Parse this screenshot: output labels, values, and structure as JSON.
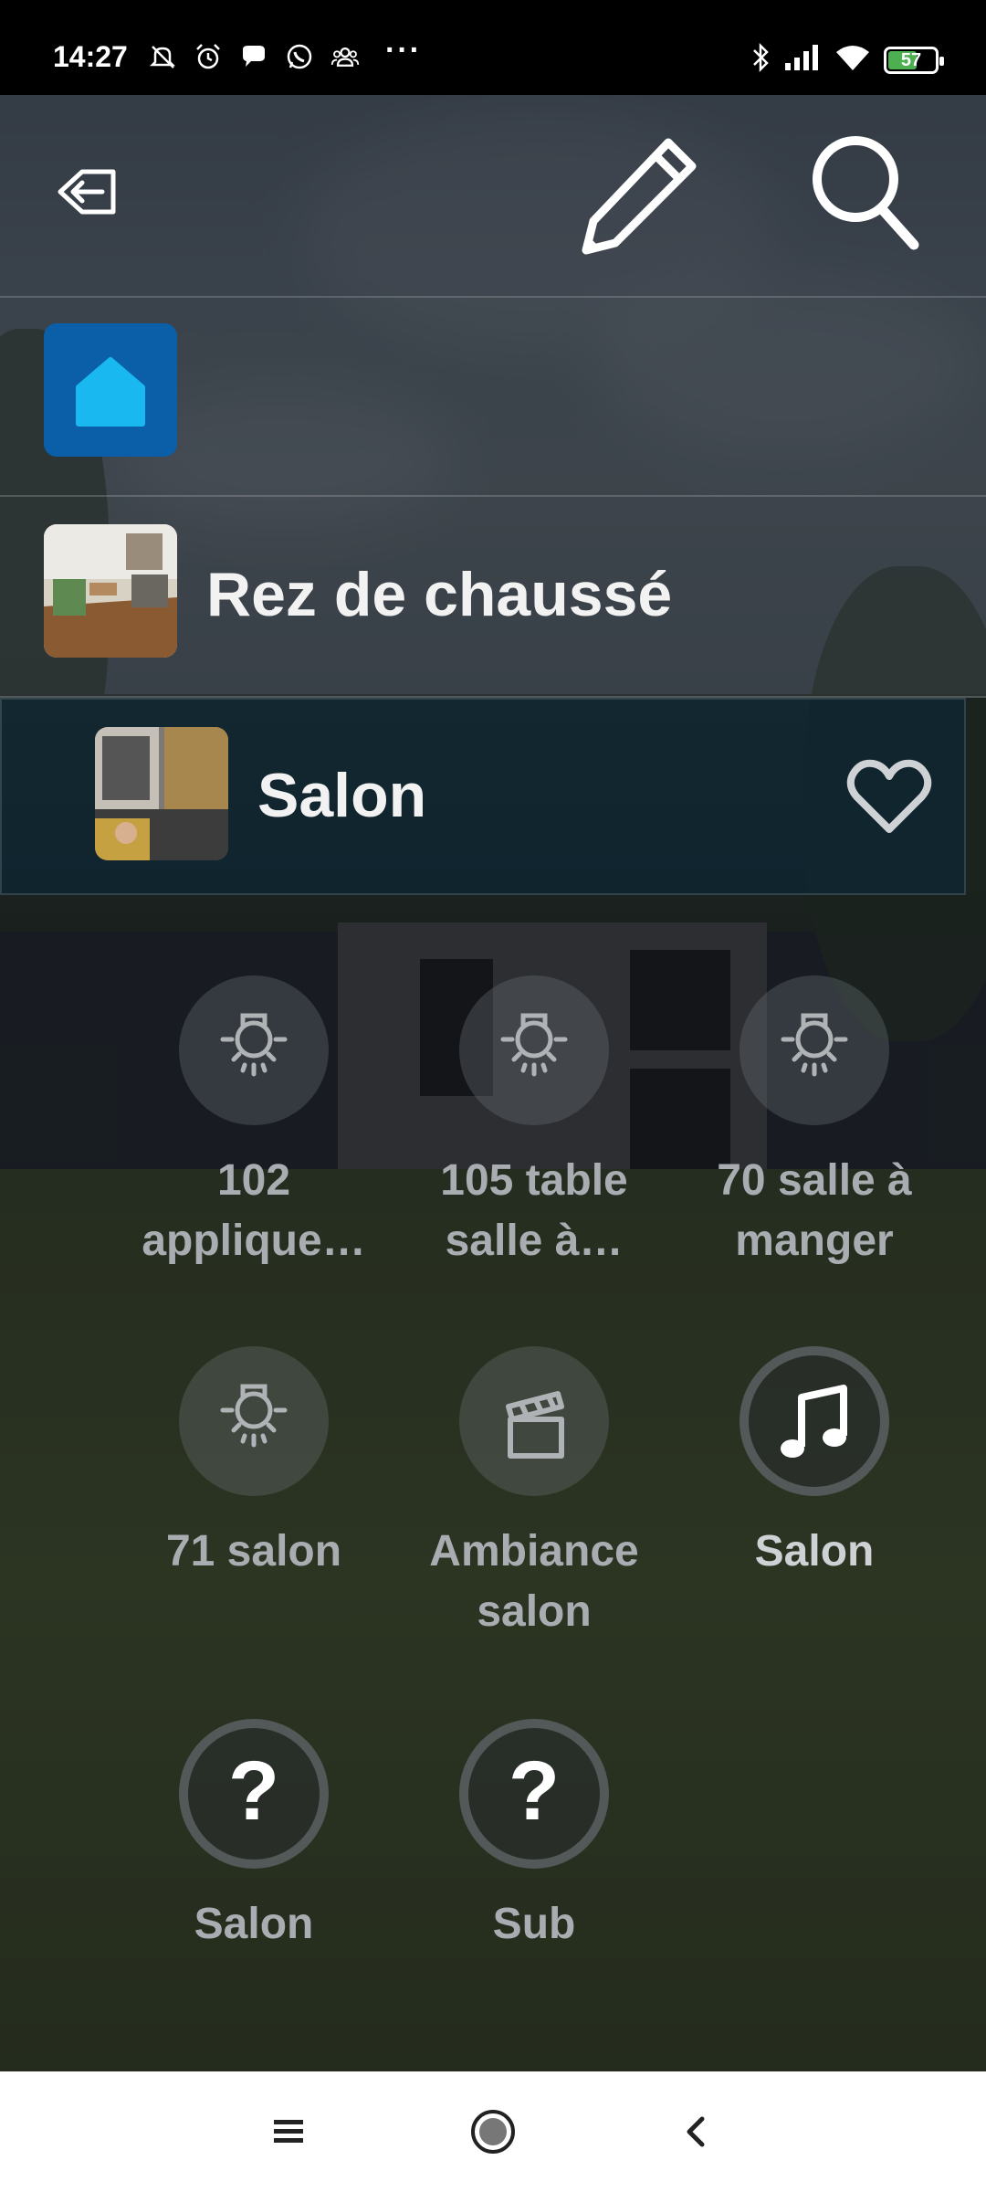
{
  "status_bar": {
    "time": "14:27",
    "notification_icons": [
      "muted-bell-icon",
      "alarm-icon",
      "chat-bubble-icon",
      "whatsapp-icon",
      "group-icon"
    ],
    "more": "···",
    "battery_level": "57"
  },
  "header": {
    "back_icon": "exit-home-icon",
    "edit_icon": "pencil-icon",
    "search_icon": "search-icon"
  },
  "home": {
    "icon": "home-icon",
    "color": "#0a5fa8"
  },
  "floor": {
    "label": "Rez de chaussé"
  },
  "room": {
    "label": "Salon",
    "favorite_icon": "heart-outline-icon"
  },
  "devices": [
    {
      "label": "102 applique…",
      "icon": "lightbulb-icon",
      "state": "off"
    },
    {
      "label": "105 table salle à…",
      "icon": "lightbulb-icon",
      "state": "off"
    },
    {
      "label": "70 salle à manger",
      "icon": "lightbulb-icon",
      "state": "off"
    },
    {
      "label": "71 salon",
      "icon": "lightbulb-icon",
      "state": "off"
    },
    {
      "label": "Ambiance salon",
      "icon": "clapperboard-icon",
      "state": "off"
    },
    {
      "label": "Salon",
      "icon": "music-note-icon",
      "state": "active"
    },
    {
      "label": "Salon",
      "icon": "question-mark-icon",
      "state": "unknown"
    },
    {
      "label": "Sub",
      "icon": "question-mark-icon",
      "state": "unknown"
    }
  ],
  "nav_bar": {
    "buttons": [
      "menu-icon",
      "home-circle-icon",
      "back-chevron-icon"
    ]
  }
}
